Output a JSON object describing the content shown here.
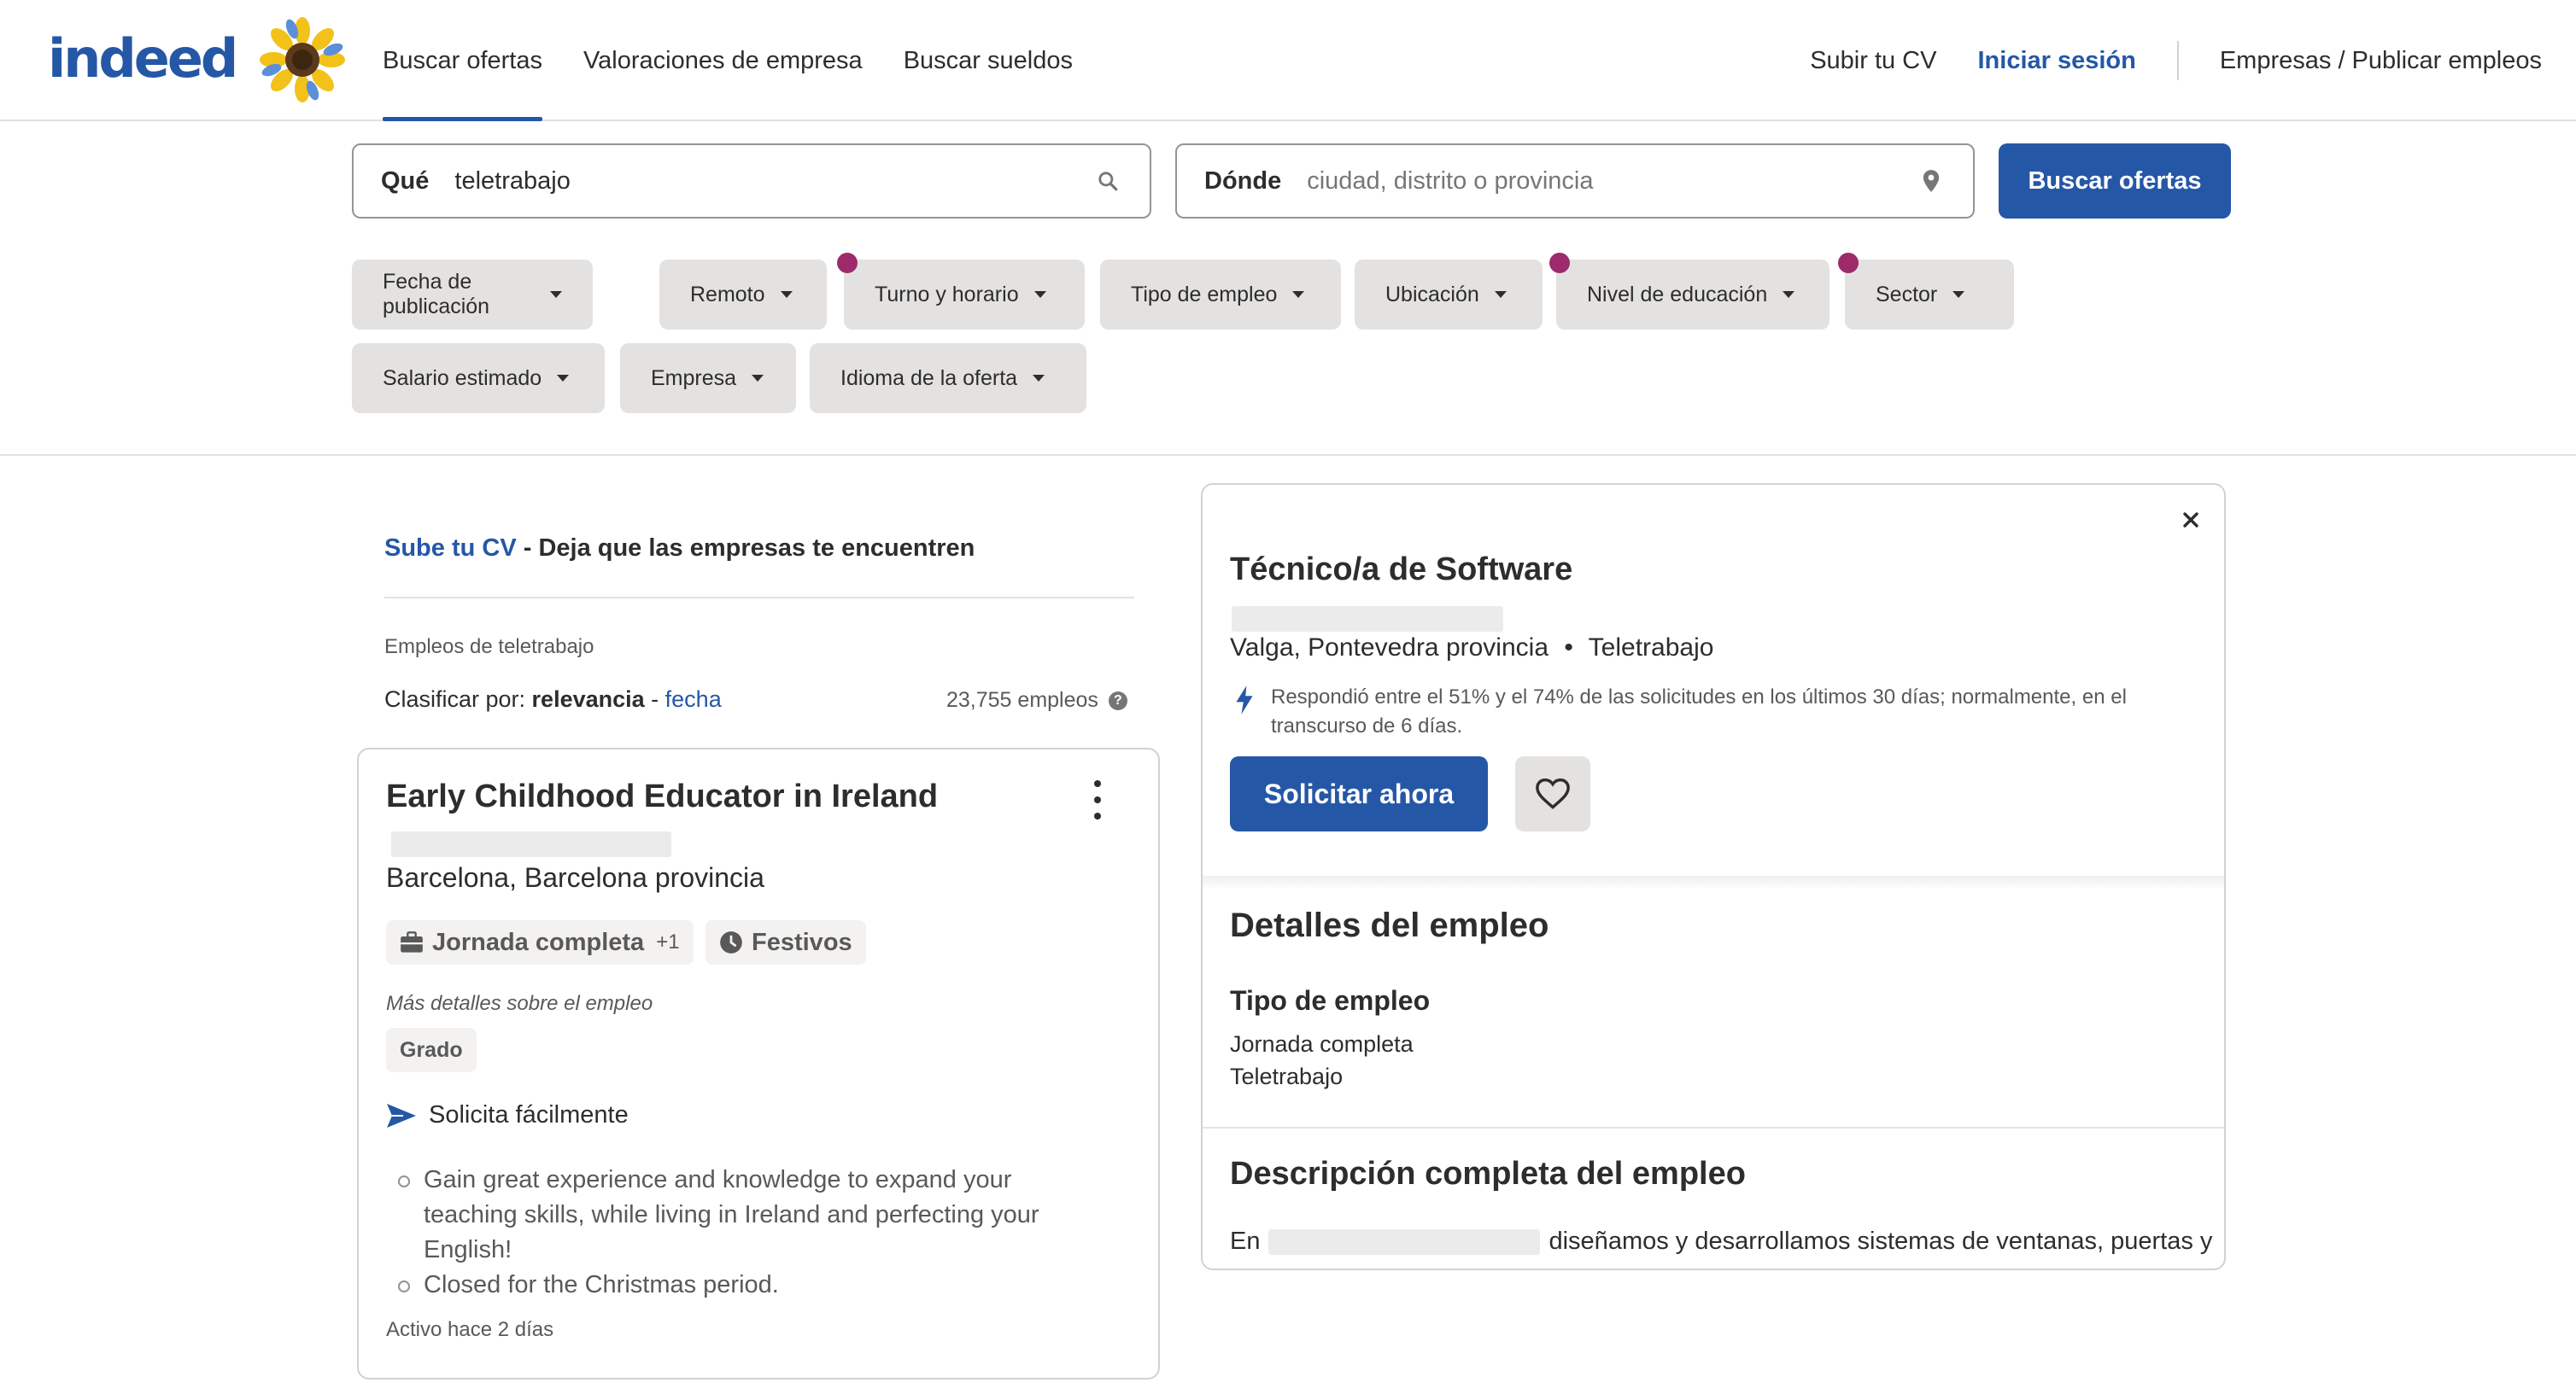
{
  "header": {
    "logo_text": "indeed",
    "nav": [
      "Buscar ofertas",
      "Valoraciones de empresa",
      "Buscar sueldos"
    ],
    "upload_cv": "Subir tu CV",
    "sign_in": "Iniciar sesión",
    "employers": "Empresas / Publicar empleos"
  },
  "search": {
    "what_label": "Qué",
    "what_value": "teletrabajo",
    "where_label": "Dónde",
    "where_placeholder": "ciudad, distrito o provincia",
    "button": "Buscar ofertas"
  },
  "filters": [
    "Fecha de publicación",
    "Remoto",
    "Turno y horario",
    "Tipo de empleo",
    "Ubicación",
    "Nivel de educación",
    "Sector",
    "Salario estimado",
    "Empresa",
    "Idioma de la oferta"
  ],
  "results": {
    "upload_link": "Sube tu CV",
    "upload_rest": " - Deja que las empresas te encuentren",
    "caption": "Empleos de teletrabajo",
    "sort_prefix": "Clasificar por: ",
    "sort_active": "relevancia",
    "sort_sep": " - ",
    "sort_other": "fecha",
    "count": "23,755 empleos"
  },
  "job_card": {
    "title": "Early Childhood Educator in Ireland",
    "location": "Barcelona, Barcelona provincia",
    "tag_schedule": "Jornada completa",
    "tag_schedule_more": "+1",
    "tag_holidays": "Festivos",
    "more_details": "Más detalles sobre el empleo",
    "education": "Grado",
    "easy_apply": "Solicita fácilmente",
    "bullets": [
      "Gain great experience and knowledge to expand your teaching skills, while living in Ireland and perfecting your English!",
      "Closed for the Christmas period."
    ],
    "posted": "Activo hace 2 días"
  },
  "detail": {
    "title": "Técnico/a de Software",
    "location": "Valga, Pontevedra provincia",
    "remote": "Teletrabajo",
    "response_line1": "Respondió entre el 51% y el 74% de las solicitudes en los últimos 30 días; normalmente, en el",
    "response_line2": "transcurso de 6 días.",
    "apply": "Solicitar ahora",
    "details_heading": "Detalles del empleo",
    "type_heading": "Tipo de empleo",
    "type_values": [
      "Jornada completa",
      "Teletrabajo"
    ],
    "description_heading": "Descripción completa del empleo",
    "description_start": "En",
    "description_rest": "diseñamos y desarrollamos sistemas de ventanas, puertas y"
  },
  "colors": {
    "brand_blue": "#2557a7",
    "filter_bg": "#e4e2e0",
    "notification_dot": "#9d2b6b"
  },
  "icons": [
    "sunflower-icon",
    "search-icon",
    "location-pin-icon",
    "caret-down-icon",
    "help-icon",
    "more-vertical-icon",
    "briefcase-icon",
    "clock-icon",
    "send-icon",
    "lightning-icon",
    "heart-icon",
    "close-icon"
  ]
}
